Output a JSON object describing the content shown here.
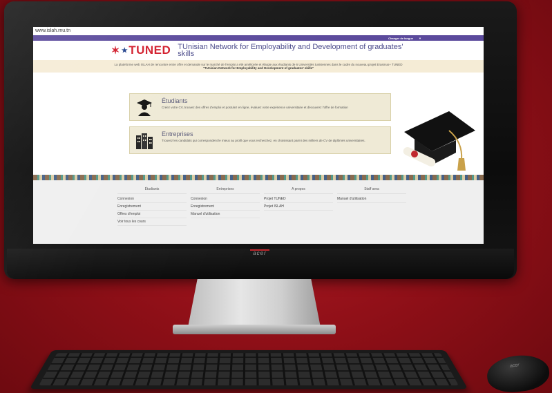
{
  "browser": {
    "url": "www.islah.rnu.tn"
  },
  "topbar": {
    "language_label": "Changer de langue"
  },
  "header": {
    "logo_text": "TUNED",
    "tagline": "TUnisian Network for Employability and Development of graduates' skills"
  },
  "banner": {
    "line1": "La plateforme web ISLAH de rencontre entre offre et demande sur le marché de l'emploi a été améliorée et élargie aux étudiants de 6 Universités tunisiennes dans le cadre du nouveau projet Erasmus+ TUNED",
    "line2": "\"TUnisian Network for Employability and Development of graduates' skills\""
  },
  "cards": [
    {
      "title": "Étudiants",
      "description": "Créez votre CV, trouvez des offres d'emploi et postulez en ligne, évaluez votre expérience universitaire et découvrez l'offre de formation",
      "icon": "graduate-icon"
    },
    {
      "title": "Entreprises",
      "description": "Trouvez les candidats qui correspondent le mieux au profil que vous recherchez, en choisissant parmi des milliers de CV de diplômés universitaires.",
      "icon": "buildings-icon"
    }
  ],
  "footer": {
    "columns": [
      {
        "heading": "Étudiants",
        "links": [
          "Connexion",
          "Enregistrement",
          "Offres d'emploi",
          "Voir tous les cours"
        ]
      },
      {
        "heading": "Entreprises",
        "links": [
          "Connexion",
          "Enregistrement",
          "Manuel d'utilisation"
        ]
      },
      {
        "heading": "A propos",
        "links": [
          "Projet TUNED",
          "Projet ISLAH"
        ]
      },
      {
        "heading": "Staff area",
        "links": [
          "Manuel d'utilisation"
        ]
      }
    ]
  },
  "device": {
    "brand": "acer"
  },
  "colors": {
    "background": "#9a121b",
    "topbar": "#5b4a9c",
    "logo": "#d21b2a",
    "card": "#efead6",
    "banner": "#f5ecd6"
  }
}
